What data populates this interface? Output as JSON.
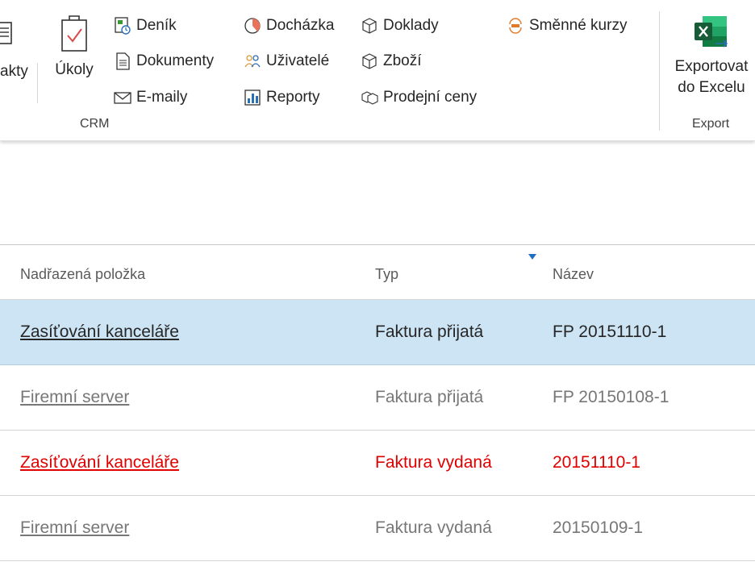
{
  "ribbon": {
    "crm_group_label": "CRM",
    "export_group_label": "Export",
    "partial_left_label": "akty",
    "tasks_label": "Úkoly",
    "items": {
      "journal": "Deník",
      "documents": "Dokumenty",
      "emails": "E-maily",
      "attendance": "Docházka",
      "users": "Uživatelé",
      "reports": "Reporty",
      "receipts": "Doklady",
      "goods": "Zboží",
      "sale_prices": "Prodejní ceny",
      "exchange_rates": "Směnné kurzy"
    },
    "export_line1": "Exportovat",
    "export_line2": "do Excelu"
  },
  "grid": {
    "columns": [
      "Nadřazená položka",
      "Typ",
      "Název"
    ],
    "sorted_column": "Název",
    "rows": [
      {
        "parent": "Zasíťování kanceláře",
        "type": "Faktura přijatá",
        "name": "FP 20151110-1",
        "state": "selected"
      },
      {
        "parent": "Firemní server",
        "type": "Faktura přijatá",
        "name": "FP 20150108-1",
        "state": "grey"
      },
      {
        "parent": "Zasíťování kanceláře",
        "type": "Faktura vydaná",
        "name": "20151110-1",
        "state": "red"
      },
      {
        "parent": "Firemní server",
        "type": "Faktura vydaná",
        "name": "20150109-1",
        "state": "grey"
      }
    ]
  },
  "colors": {
    "selected_row": "#cce4f4",
    "red_text": "#e00000",
    "grey_text": "#777777",
    "excel_green": "#1e7145"
  }
}
